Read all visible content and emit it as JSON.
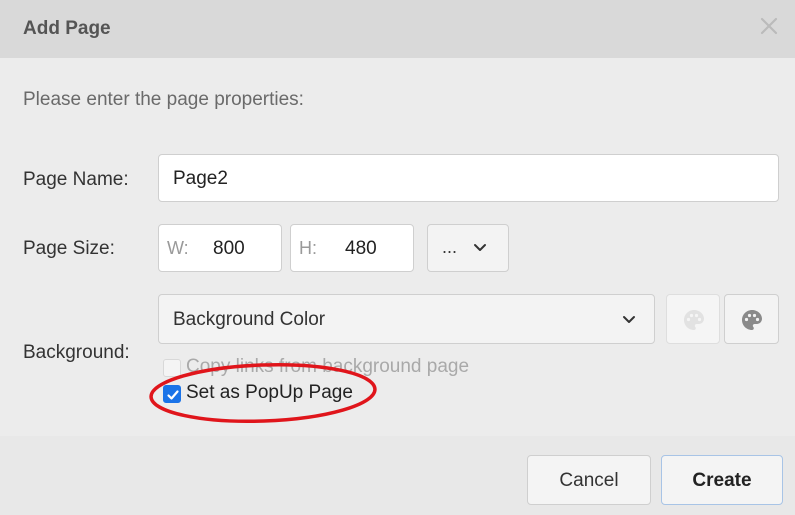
{
  "dialog": {
    "title": "Add Page",
    "intro": "Please enter the page properties:"
  },
  "fields": {
    "page_name_label": "Page Name:",
    "page_name_value": "Page2",
    "page_size_label": "Page Size:",
    "width_prefix": "W:",
    "width_value": "800",
    "height_prefix": "H:",
    "height_value": "480",
    "more_label": "...",
    "background_label": "Background:",
    "background_select": "Background Color",
    "copy_links_label": "Copy links from background page",
    "copy_links_checked": false,
    "popup_label": "Set as PopUp Page",
    "popup_checked": true
  },
  "buttons": {
    "cancel": "Cancel",
    "create": "Create"
  },
  "icons": {
    "close": "close-icon",
    "chevron": "chevron-down-icon",
    "palette": "palette-icon"
  },
  "colors": {
    "checkbox_accent": "#1a73e8",
    "annotation": "#e0151b"
  }
}
